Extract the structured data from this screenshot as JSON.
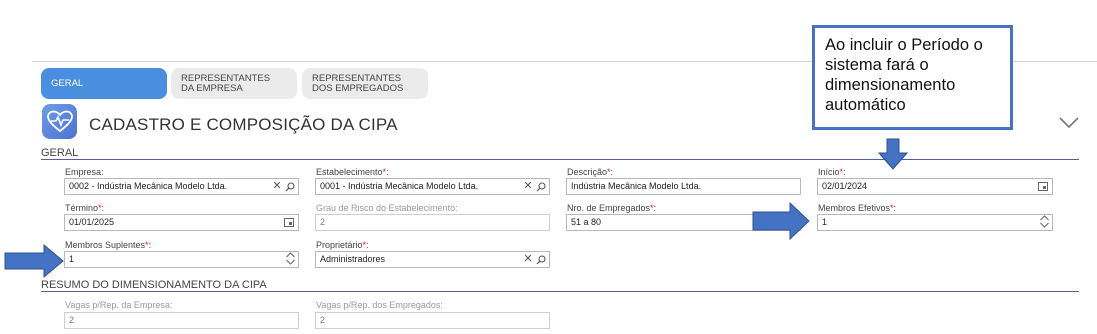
{
  "tabs": [
    {
      "label": "GERAL"
    },
    {
      "label": "REPRESENTANTES DA EMPRESA"
    },
    {
      "label": "REPRESENTANTES DOS EMPREGADOS"
    }
  ],
  "page": {
    "title": "CADASTRO E COMPOSIÇÃO DA CIPA"
  },
  "sections": {
    "geral": "GERAL",
    "resumo": "RESUMO DO DIMENSIONAMENTO DA CIPA"
  },
  "fields": {
    "empresa": {
      "label": "Empresa:",
      "value": "0002 - Indústria Mecânica Modelo Ltda."
    },
    "estabelecimento": {
      "label": "Estabelecimento",
      "value": "0001 - Indústria Mecânica Modelo Ltda."
    },
    "descricao": {
      "label": "Descrição",
      "value": "Indústria Mecânica Modelo Ltda."
    },
    "inicio": {
      "label": "Início",
      "value": "02/01/2024"
    },
    "termino": {
      "label": "Término",
      "value": "01/01/2025"
    },
    "grau_risco": {
      "label": "Grau de Risco do Estabelecimento:",
      "value": "2"
    },
    "nro_empregados": {
      "label": "Nro. de Empregados",
      "value": "51 a 80"
    },
    "membros_efetivos": {
      "label": "Membros Efetivos",
      "value": "1"
    },
    "membros_suplentes": {
      "label": "Membros Suplentes",
      "value": "1"
    },
    "proprietario": {
      "label": "Proprietário",
      "value": "Administradores"
    },
    "vagas_empresa": {
      "label": "Vagas p/Rep. da Empresa:",
      "value": "2"
    },
    "vagas_empregados": {
      "label": "Vagas p/Rep. dos Empregados:",
      "value": "2"
    }
  },
  "required_suffix": "*",
  "colon": ":",
  "callout": {
    "text": "Ao incluir o Período o sistema fará o dimensionamento automático"
  },
  "colors": {
    "accent": "#4a8ee0",
    "arrow": "#4472c4",
    "section_line": "#5a5ca8",
    "required": "#e02020"
  }
}
